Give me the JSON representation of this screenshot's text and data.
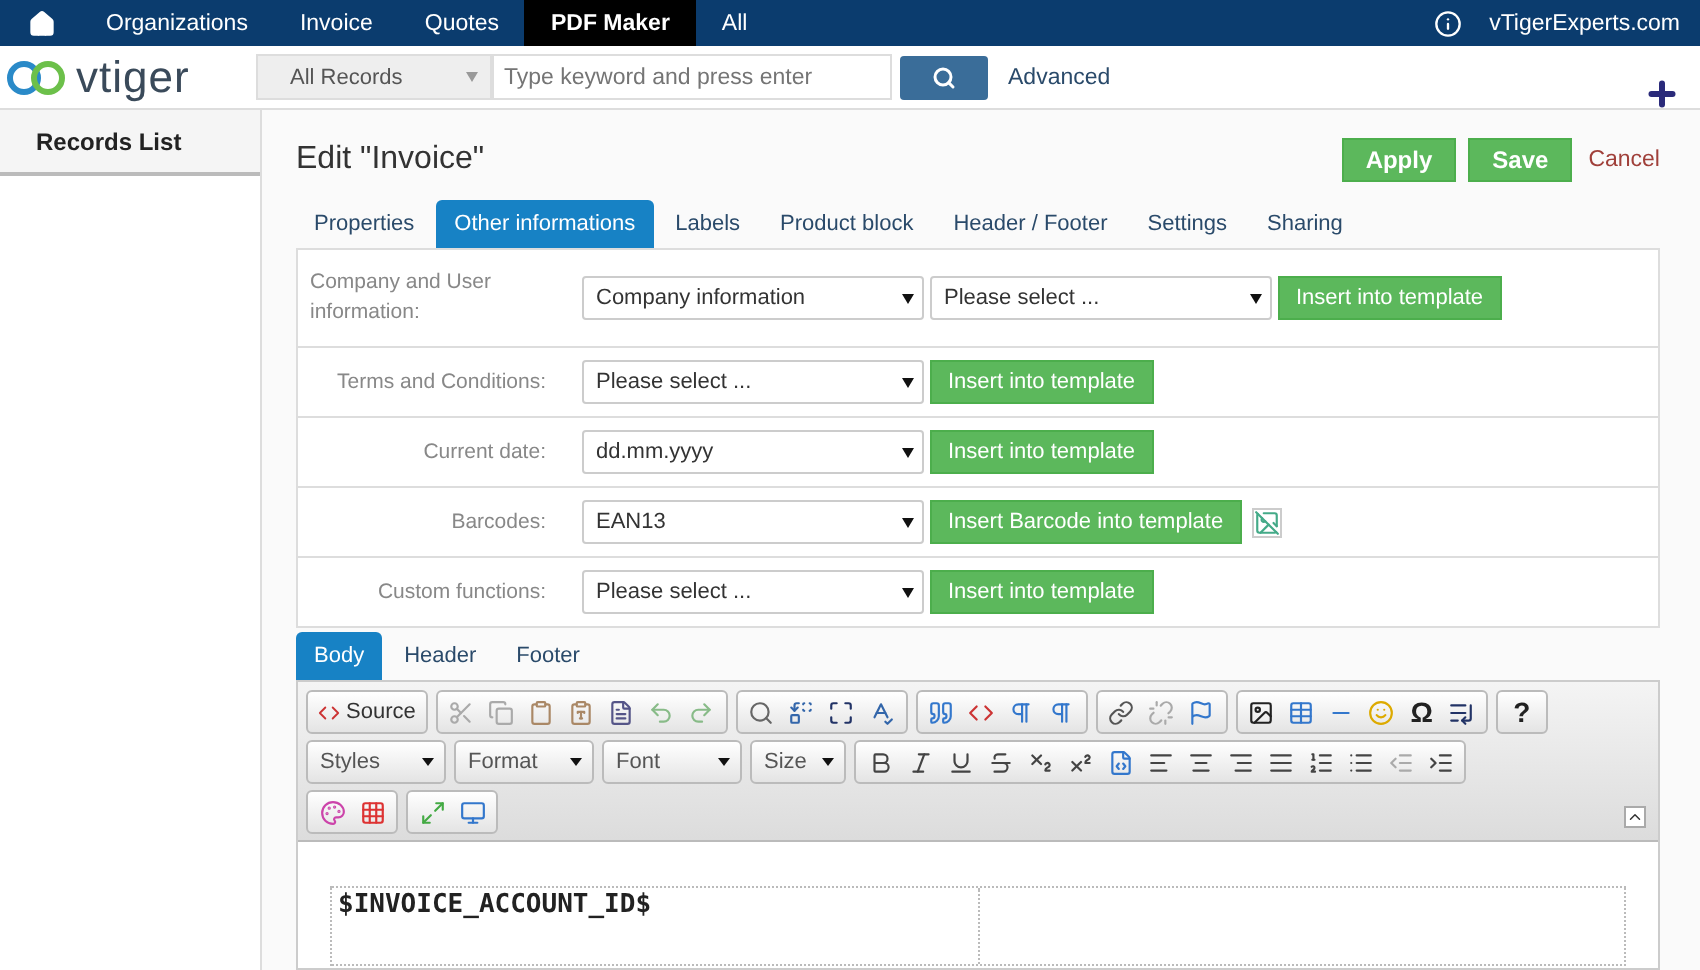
{
  "nav": {
    "items": [
      {
        "label": "Organizations",
        "selected": false
      },
      {
        "label": "Invoice",
        "selected": false
      },
      {
        "label": "Quotes",
        "selected": false
      },
      {
        "label": "PDF Maker",
        "selected": true
      },
      {
        "label": "All",
        "selected": false
      }
    ],
    "site": "vTigerExperts.com"
  },
  "header": {
    "logo": "vtiger",
    "scope": "All Records",
    "search_placeholder": "Type keyword and press enter",
    "advanced": "Advanced"
  },
  "sidebar": {
    "title": "Records List"
  },
  "page": {
    "title": "Edit \"Invoice\"",
    "buttons": [
      "Apply",
      "Save"
    ],
    "cancel": "Cancel"
  },
  "tabs": [
    {
      "label": "Properties",
      "selected": false
    },
    {
      "label": "Other informations",
      "selected": true
    },
    {
      "label": "Labels",
      "selected": false
    },
    {
      "label": "Product block",
      "selected": false
    },
    {
      "label": "Header / Footer",
      "selected": false
    },
    {
      "label": "Settings",
      "selected": false
    },
    {
      "label": "Sharing",
      "selected": false
    }
  ],
  "rows": [
    {
      "label": "Company and User information:",
      "selects": [
        "Company information",
        "Please select ..."
      ],
      "button": "Insert into template",
      "preview": false
    },
    {
      "label": "Terms and Conditions:",
      "selects": [
        "Please select ..."
      ],
      "button": "Insert into template",
      "preview": false
    },
    {
      "label": "Current date:",
      "selects": [
        "dd.mm.yyyy"
      ],
      "button": "Insert into template",
      "preview": false
    },
    {
      "label": "Barcodes:",
      "selects": [
        "EAN13"
      ],
      "button": "Insert Barcode into template",
      "preview": true
    },
    {
      "label": "Custom functions:",
      "selects": [
        "Please select ..."
      ],
      "button": "Insert into template",
      "preview": false
    }
  ],
  "section_tabs": [
    {
      "label": "Body",
      "selected": true
    },
    {
      "label": "Header",
      "selected": false
    },
    {
      "label": "Footer",
      "selected": false
    }
  ],
  "editor": {
    "source": "Source",
    "dropdowns": [
      "Styles",
      "Format",
      "Font",
      "Size"
    ],
    "special_char": "Ω",
    "help": "?",
    "content": "$INVOICE_ACCOUNT_ID$"
  }
}
